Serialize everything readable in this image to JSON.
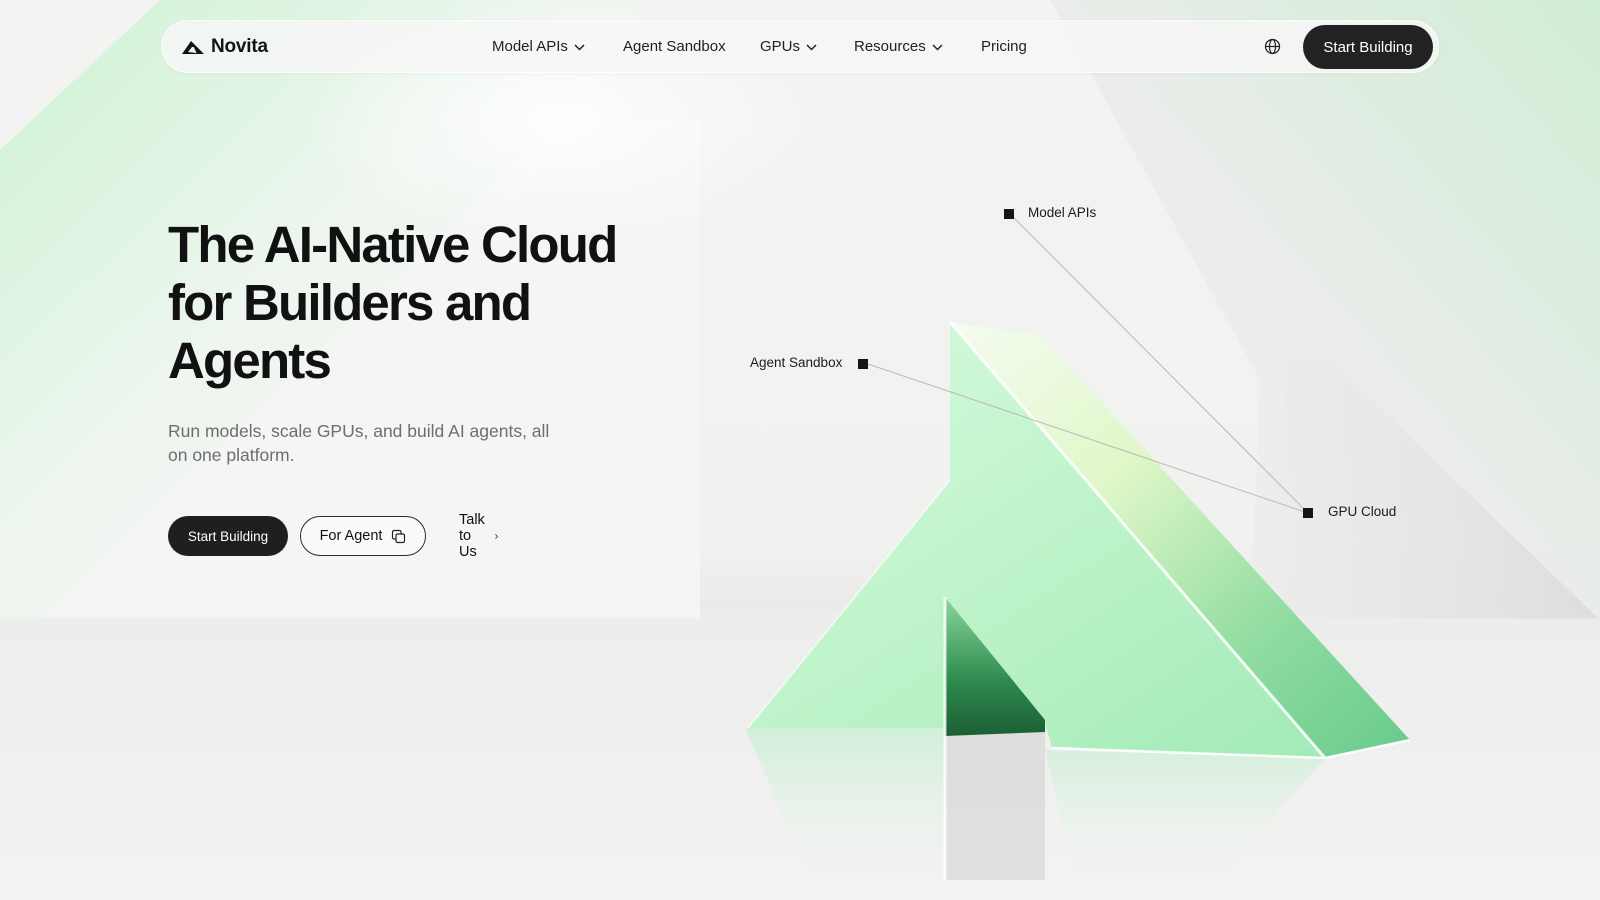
{
  "brand": {
    "name": "Novita",
    "logo_icon": "novita-triangle-logo"
  },
  "nav": {
    "items": [
      {
        "label": "Model APIs",
        "has_dropdown": true
      },
      {
        "label": "Agent Sandbox",
        "has_dropdown": false
      },
      {
        "label": "GPUs",
        "has_dropdown": true
      },
      {
        "label": "Resources",
        "has_dropdown": true
      },
      {
        "label": "Pricing",
        "has_dropdown": false
      }
    ],
    "language_icon": "globe-icon",
    "cta_label": "Start Building"
  },
  "hero": {
    "title": "The AI-Native Cloud for Builders and Agents",
    "subtitle": "Run models, scale GPUs, and build AI agents, all on one platform.",
    "primary_button": "Start Building",
    "secondary_button": "For Agent",
    "secondary_icon": "copy-icon",
    "link_button": "Talk to Us",
    "link_icon": "chevron-right-icon"
  },
  "diagram": {
    "labels": {
      "model_apis": "Model APIs",
      "agent_sandbox": "Agent Sandbox",
      "gpu_cloud": "GPU Cloud"
    }
  },
  "colors": {
    "accent_green": "#8fe6a8",
    "dark": "#1f1f1f",
    "background": "#f2f2f1"
  }
}
